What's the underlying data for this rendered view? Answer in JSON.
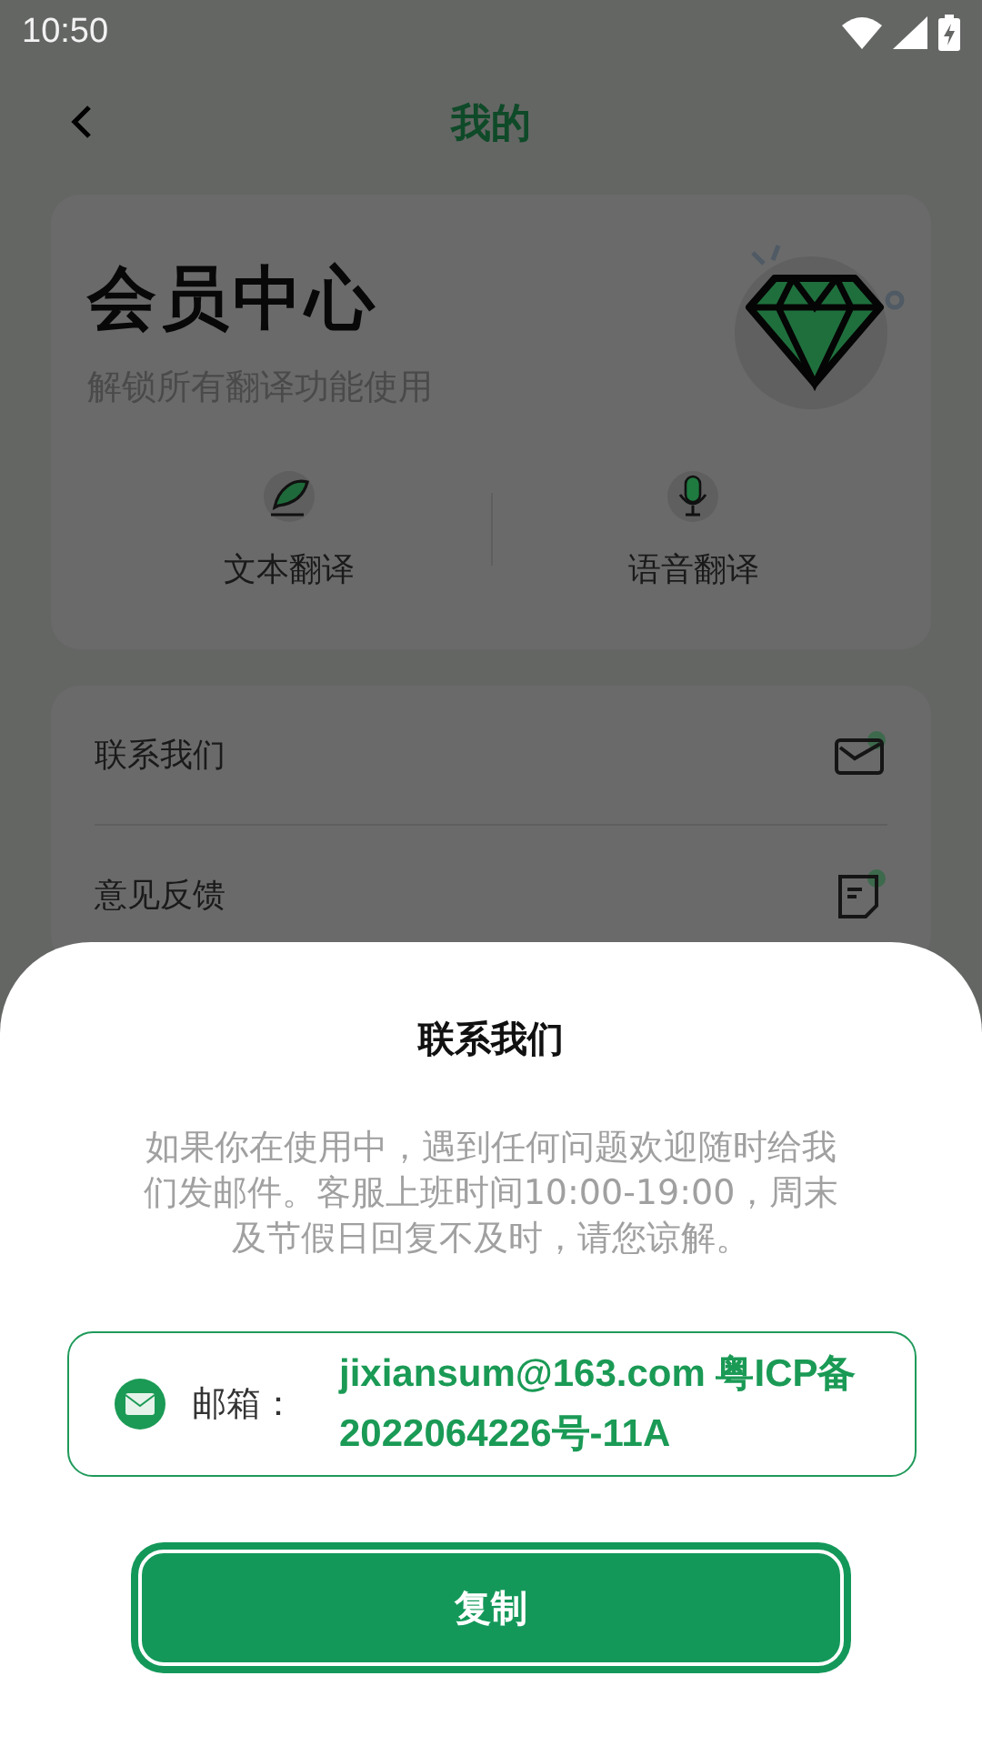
{
  "status_bar": {
    "time": "10:50"
  },
  "header": {
    "title": "我的"
  },
  "member_card": {
    "title": "会员中心",
    "subtitle": "解锁所有翻译功能使用",
    "features": [
      {
        "kind": "text",
        "label": "文本翻译"
      },
      {
        "kind": "voice",
        "label": "语音翻译"
      }
    ]
  },
  "menu": [
    {
      "kind": "mail",
      "label": "联系我们"
    },
    {
      "kind": "feedback",
      "label": "意见反馈"
    }
  ],
  "dialog": {
    "title": "联系我们",
    "message": "如果你在使用中，遇到任何问题欢迎随时给我们发邮件。客服上班时间10:00-19:00，周末及节假日回复不及时，请您谅解。",
    "email": {
      "label": "邮箱：",
      "value": "jixiansum@163.com 粤ICP备2022064226号-11A"
    },
    "button": "复制"
  }
}
